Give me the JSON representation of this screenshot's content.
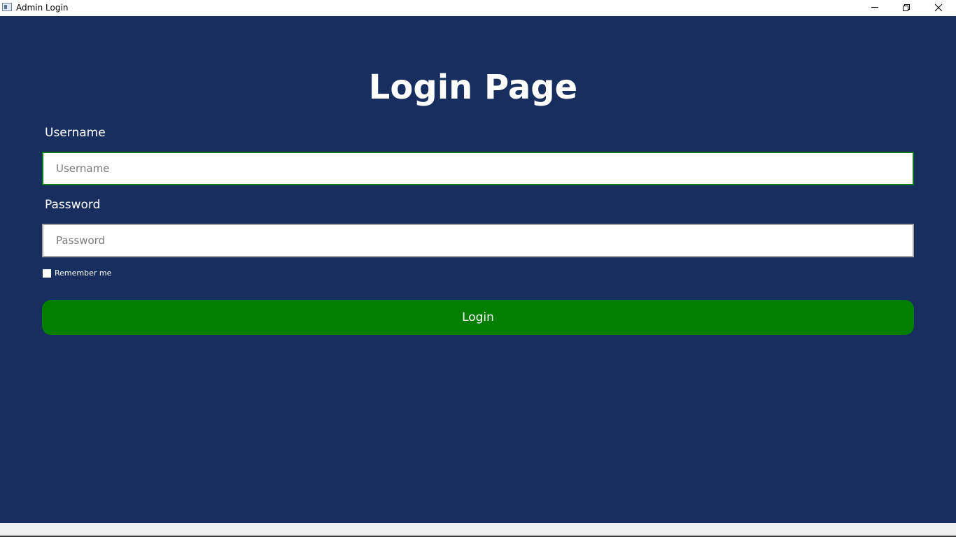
{
  "window": {
    "title": "Admin Login",
    "controls": [
      "minimize-icon",
      "restore-icon",
      "close-icon"
    ]
  },
  "page": {
    "heading": "Login Page",
    "username": {
      "label": "Username",
      "placeholder": "Username",
      "value": ""
    },
    "password": {
      "label": "Password",
      "placeholder": "Password",
      "value": ""
    },
    "remember": {
      "label": "Remember me",
      "checked": false
    },
    "login_button": "Login"
  },
  "colors": {
    "background": "#182e5f",
    "accent_button": "#027f01",
    "focused_border": "#0c7a16",
    "text": "#ffffff"
  }
}
